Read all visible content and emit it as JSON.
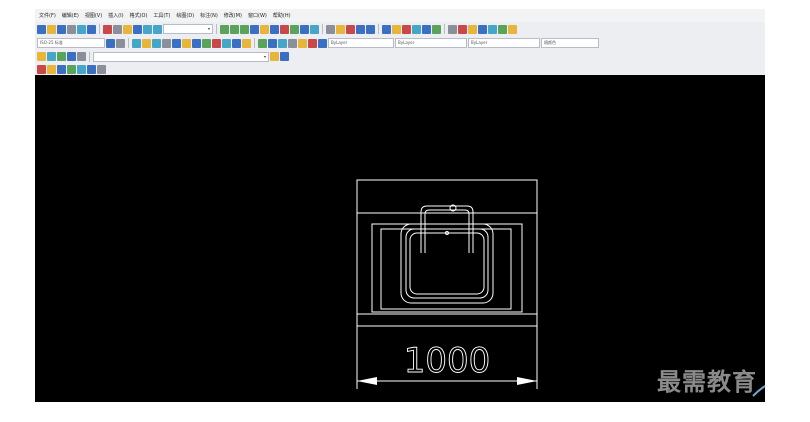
{
  "menubar": {
    "items": [
      "文件(F)",
      "编辑(E)",
      "视图(V)",
      "插入(I)",
      "格式(O)",
      "工具(T)",
      "绘图(D)",
      "标注(N)",
      "修改(M)",
      "窗口(W)",
      "帮助(H)"
    ]
  },
  "toolbar2": {
    "style_combo": "ISO-25 标准",
    "layer_combo": "ByLayer",
    "linetype_combo": "ByLayer",
    "lineweight_combo": "ByLayer",
    "plotstyle_combo": "随颜色"
  },
  "drawing": {
    "dimension_text": "1000",
    "background": "#000000",
    "line_color": "#ffffff"
  },
  "watermark": {
    "text": "最需教育"
  },
  "colors": {
    "canvas": "#000000",
    "toolbar": "#eceef2",
    "watermark": "#8a8a8a"
  }
}
